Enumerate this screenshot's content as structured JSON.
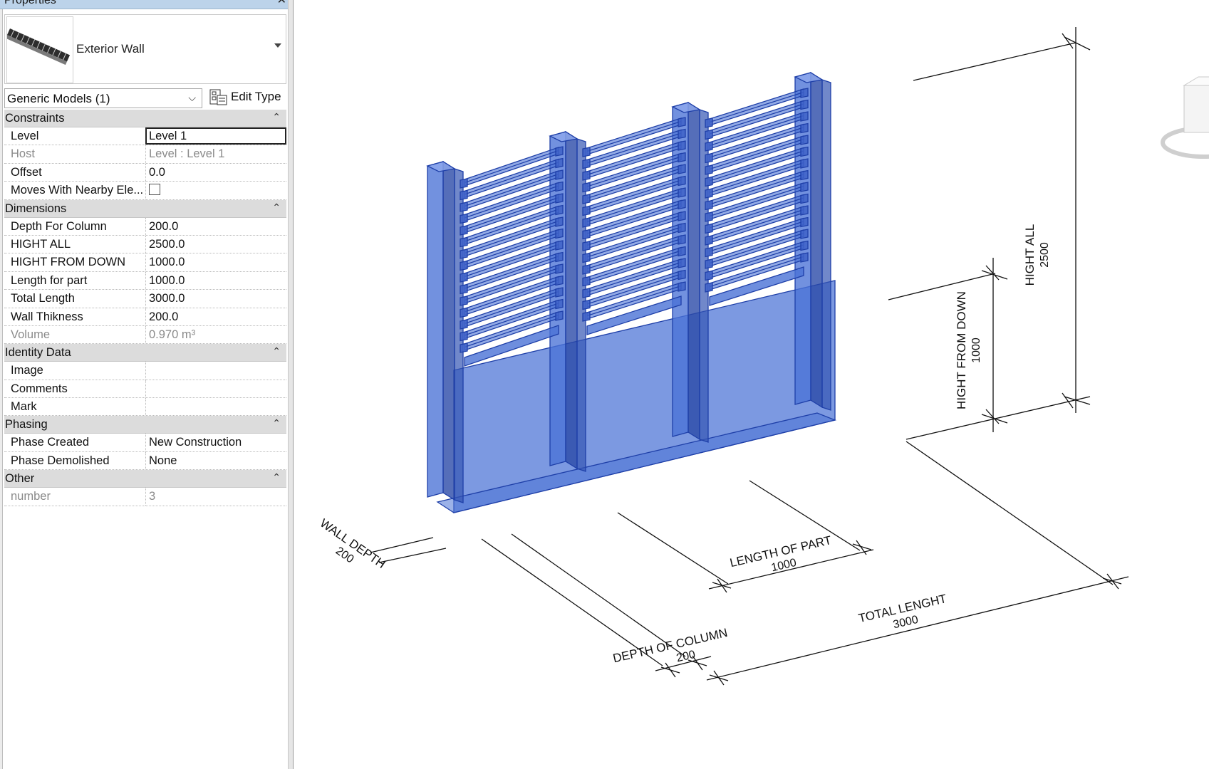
{
  "properties": {
    "title": "Properties",
    "close_glyph": "✕",
    "type_name": "Exterior Wall",
    "filter": "Generic Models (1)",
    "edit_type": "Edit Type",
    "sections": {
      "constraints": {
        "title": "Constraints",
        "level": {
          "k": "Level",
          "v": "Level 1"
        },
        "host": {
          "k": "Host",
          "v": "Level : Level 1"
        },
        "offset": {
          "k": "Offset",
          "v": "0.0"
        },
        "moves": {
          "k": "Moves With Nearby Ele...",
          "v": false
        }
      },
      "dimensions": {
        "title": "Dimensions",
        "depth_column": {
          "k": "Depth For Column",
          "v": "200.0"
        },
        "hight_all": {
          "k": "HIGHT ALL",
          "v": "2500.0"
        },
        "hight_down": {
          "k": "HIGHT FROM DOWN",
          "v": "1000.0"
        },
        "length_part": {
          "k": "Length for part",
          "v": "1000.0"
        },
        "total_length": {
          "k": "Total Length",
          "v": "3000.0"
        },
        "wall_thickness": {
          "k": "Wall Thikness",
          "v": "200.0"
        },
        "volume": {
          "k": "Volume",
          "v": "0.970 m³"
        }
      },
      "identity": {
        "title": "Identity Data",
        "image": {
          "k": "Image",
          "v": ""
        },
        "comments": {
          "k": "Comments",
          "v": ""
        },
        "mark": {
          "k": "Mark",
          "v": ""
        }
      },
      "phasing": {
        "title": "Phasing",
        "created": {
          "k": "Phase Created",
          "v": "New Construction"
        },
        "demolished": {
          "k": "Phase Demolished",
          "v": "None"
        }
      },
      "other": {
        "title": "Other",
        "number": {
          "k": "number",
          "v": "3"
        }
      }
    },
    "collapse_glyph": "«"
  },
  "viewport": {
    "model_color": "#4a72d6",
    "dims": {
      "hight_all": {
        "label": "HIGHT ALL",
        "value": "2500"
      },
      "hight_down": {
        "label": "HIGHT FROM DOWN",
        "value": "1000"
      },
      "length_part": {
        "label": "LENGTH OF PART",
        "value": "1000"
      },
      "total": {
        "label": "TOTAL LENGHT",
        "value": "3000"
      },
      "depth_column": {
        "label": "DEPTH OF COLUMN",
        "value": "200"
      },
      "wall_depth": {
        "label": "WALL DEPTH",
        "value": "200"
      }
    }
  }
}
